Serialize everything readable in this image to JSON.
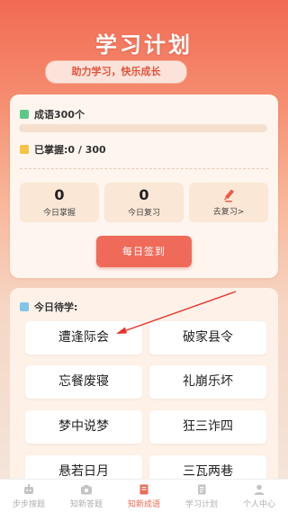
{
  "header": {
    "title": "学习计划",
    "subtitle": "助力学习，快乐成长"
  },
  "progress": {
    "total_label": "成语300个",
    "mastered_label": "已掌握:0 / 300",
    "mastered_fraction": 0,
    "stats": [
      {
        "value": "0",
        "label": "今日掌握"
      },
      {
        "value": "0",
        "label": "今日复习"
      },
      {
        "icon": "pencil-icon",
        "label": "去复习>"
      }
    ],
    "checkin_label": "每日签到"
  },
  "todo": {
    "title": "今日待学:",
    "idioms": [
      "遭逢际会",
      "破家县令",
      "忘餐废寝",
      "礼崩乐坏",
      "梦中说梦",
      "狂三诈四",
      "悬若日月",
      "三瓦两巷"
    ]
  },
  "tabbar": {
    "items": [
      {
        "label": "步步搜题",
        "icon": "robot-icon"
      },
      {
        "label": "知新答题",
        "icon": "camera-icon"
      },
      {
        "label": "知新成语",
        "icon": "book-icon",
        "active": true
      },
      {
        "label": "学习计划",
        "icon": "notebook-icon"
      },
      {
        "label": "个人中心",
        "icon": "person-icon"
      }
    ]
  },
  "colors": {
    "accent": "#f06a5a",
    "green_marker": "#5cc98a",
    "yellow_marker": "#f6c343",
    "blue_marker": "#7fc6e8"
  }
}
